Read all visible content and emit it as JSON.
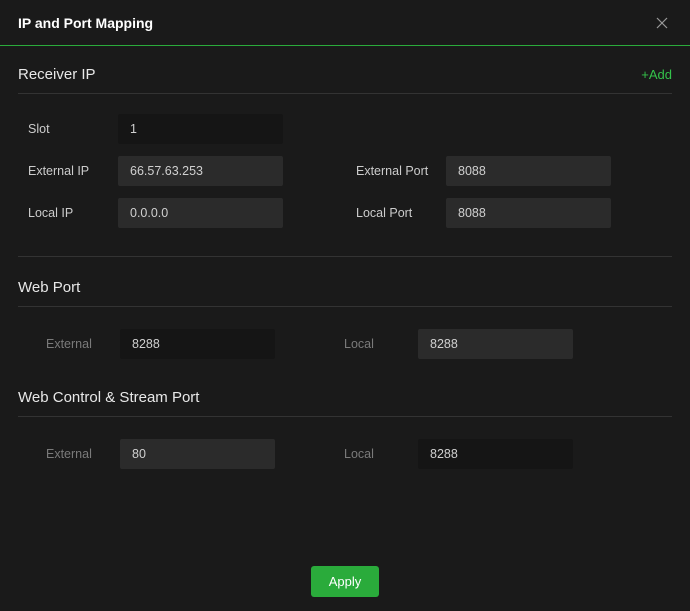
{
  "titlebar": {
    "title": "IP and Port Mapping"
  },
  "receiver": {
    "title": "Receiver IP",
    "add_label": "+Add",
    "labels": {
      "slot": "Slot",
      "external_ip": "External IP",
      "external_port": "External Port",
      "local_ip": "Local IP",
      "local_port": "Local Port"
    },
    "values": {
      "slot": "1",
      "external_ip": "66.57.63.253",
      "external_port": "8088",
      "local_ip": "0.0.0.0",
      "local_port": "8088"
    }
  },
  "web_port": {
    "title": "Web Port",
    "labels": {
      "external": "External",
      "local": "Local"
    },
    "values": {
      "external": "8288",
      "local": "8288"
    }
  },
  "web_control": {
    "title": "Web Control & Stream Port",
    "labels": {
      "external": "External",
      "local": "Local"
    },
    "values": {
      "external": "80",
      "local": "8288"
    }
  },
  "footer": {
    "apply_label": "Apply"
  }
}
